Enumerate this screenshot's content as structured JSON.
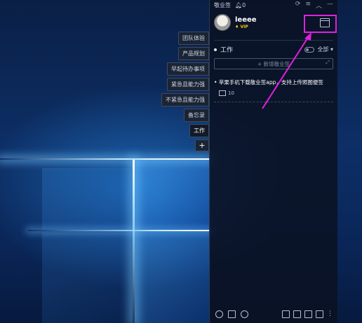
{
  "side_tabs": [
    "团队体验",
    "产品规划",
    "早起待办事项",
    "紧急且能力强",
    "不紧急且能力强",
    "备忘录",
    "工作"
  ],
  "side_tab_add": "+",
  "app": {
    "title": "敬业签",
    "notification_count": "0",
    "window_controls": [
      "refresh-icon",
      "menu-icon",
      "collapse-icon",
      "minimize-icon"
    ],
    "user": {
      "name": "leeee",
      "badge": "VIP"
    },
    "category": {
      "name": "工作",
      "filter": "全部"
    },
    "add_note_placeholder": "+ 新增敬业签",
    "expand_icon": "expand-icon",
    "notes": [
      {
        "text": "苹果手机下载敬业签app，支持上传照图便签",
        "image_count": "10"
      }
    ],
    "footer_left": [
      "clock-icon",
      "checklist-icon",
      "search-icon"
    ],
    "footer_right": [
      "add-icon",
      "calendar-icon",
      "layout-icon",
      "grid-icon",
      "more-icon"
    ]
  },
  "annotation_color": "#e020e0"
}
